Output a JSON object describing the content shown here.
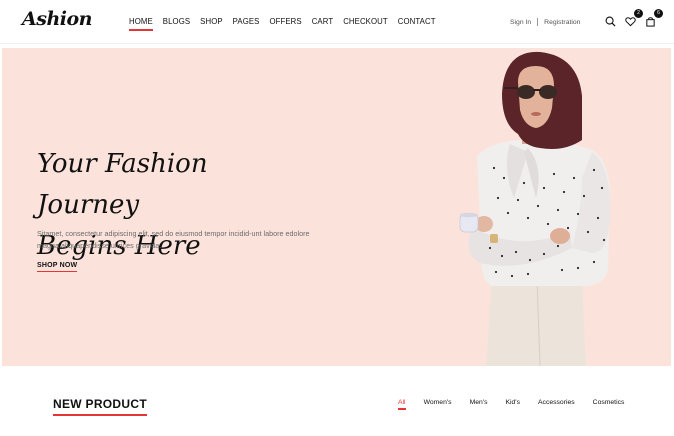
{
  "header": {
    "logo": "Ashion",
    "nav": [
      "HOME",
      "BLOGS",
      "SHOP",
      "PAGES",
      "OFFERS",
      "CART",
      "CHECKOUT",
      "CONTACT"
    ],
    "active_nav": "HOME",
    "signin": "Sign In",
    "registration": "Registration",
    "icons": [
      "search-icon",
      "heart-icon",
      "bag-icon"
    ],
    "wishlist_count": "2",
    "cart_count": "6"
  },
  "hero": {
    "title_line1": "Your Fashion Journey",
    "title_line2": "Begins Here",
    "description": "Sitamet, consectetur adipiscing elit, sed do eiusmod tempor incidid-unt labore edolore magna aliquapendisse ultrices gravida.",
    "cta": "SHOP NOW",
    "background_color": "#fbe3db"
  },
  "products": {
    "title": "NEW PRODUCT",
    "filters": [
      "All",
      "Women's",
      "Men's",
      "Kid's",
      "Accessories",
      "Cosmetics"
    ],
    "active_filter": "All"
  },
  "colors": {
    "accent": "#e53637"
  }
}
